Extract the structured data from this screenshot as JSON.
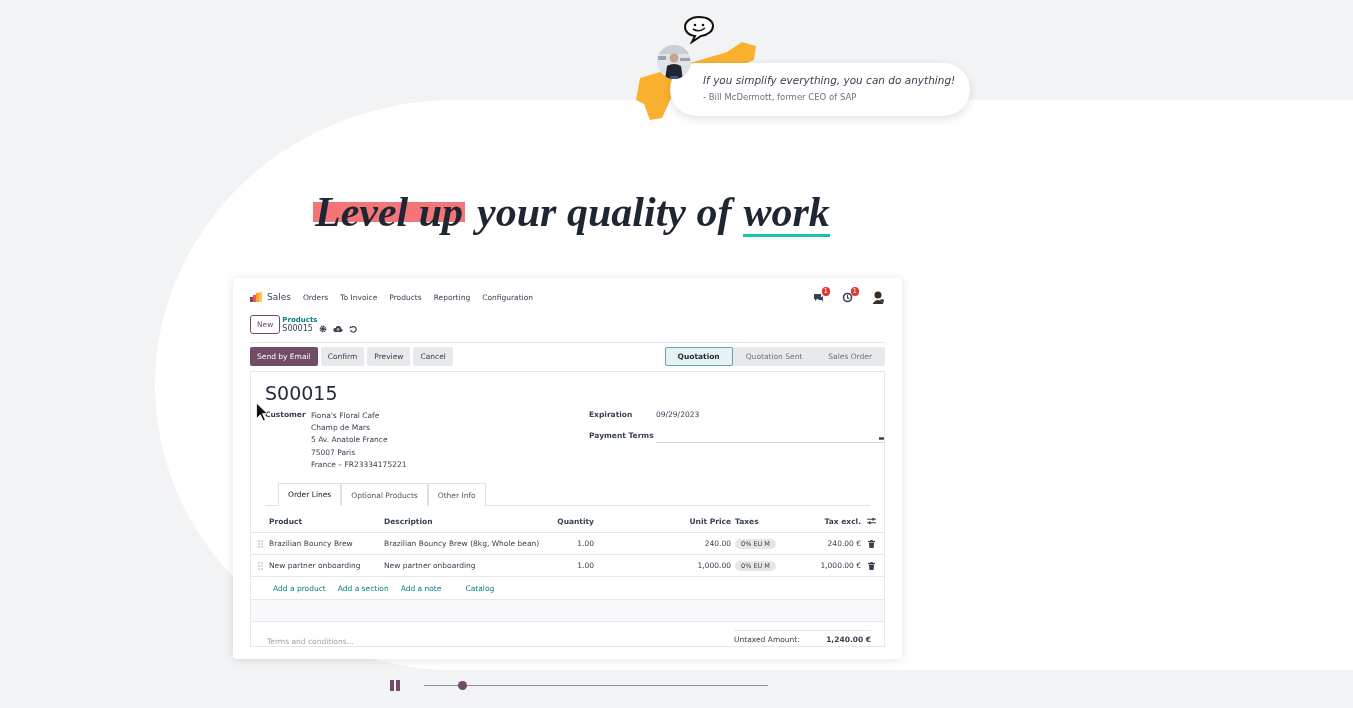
{
  "quote": {
    "text": "If you simplify everything, you can do anything!",
    "author": "- Bill McDermott, former CEO of SAP"
  },
  "headline": [
    {
      "text": "Level up",
      "kind": "highlight"
    },
    {
      "text": "your quality of",
      "kind": "plain"
    },
    {
      "text": "work",
      "kind": "underline"
    }
  ],
  "app": {
    "brand": "Sales",
    "menu": [
      "Orders",
      "To Invoice",
      "Products",
      "Reporting",
      "Configuration"
    ],
    "notifications": [
      {
        "kind": "chat",
        "count": "1"
      },
      {
        "kind": "activity",
        "count": "1"
      }
    ],
    "new_button": "New",
    "breadcrumb": "Products",
    "record": "S00015",
    "actions": [
      {
        "label": "Send by Email",
        "kind": "primary"
      },
      {
        "label": "Confirm",
        "kind": "secondary"
      },
      {
        "label": "Preview",
        "kind": "secondary"
      },
      {
        "label": "Cancel",
        "kind": "secondary"
      }
    ],
    "stages": [
      {
        "label": "Quotation",
        "selected": true
      },
      {
        "label": "Quotation Sent",
        "selected": false
      },
      {
        "label": "Sales Order",
        "selected": false
      }
    ],
    "title": "S00015",
    "customer": {
      "label": "Customer",
      "lines": [
        "Fiona's Floral Cafe",
        "Champ de Mars",
        "5 Av. Anatole France",
        "75007 Paris",
        "France – FR23334175221"
      ]
    },
    "fields": [
      {
        "label": "Expiration",
        "value": "09/29/2023",
        "kind": "text"
      },
      {
        "label": "Payment Terms",
        "kind": "select"
      }
    ],
    "tabs": [
      {
        "label": "Order Lines",
        "selected": true
      },
      {
        "label": "Optional Products",
        "selected": false
      },
      {
        "label": "Other Info",
        "selected": false
      }
    ],
    "columns": [
      "Product",
      "Description",
      "Quantity",
      "Unit Price",
      "Taxes",
      "Tax excl."
    ],
    "rows": [
      {
        "product": "Brazilian Bouncy Brew",
        "description": "Brazilian Bouncy Brew (8kg, Whole bean)",
        "quantity": "1.00",
        "unit_price": "240.00",
        "tax": "0% EU M",
        "subtotal": "240.00 €"
      },
      {
        "product": "New partner onboarding",
        "description": "New partner onboarding",
        "quantity": "1.00",
        "unit_price": "1,000.00",
        "tax": "0% EU M",
        "subtotal": "1,000.00 €"
      }
    ],
    "add_links": [
      "Add a product",
      "Add a section",
      "Add a note",
      "Catalog"
    ],
    "terms_placeholder": "Terms and conditions...",
    "totals": [
      {
        "label": "Untaxed Amount:",
        "value": "1,240.00 €"
      }
    ]
  },
  "player": {
    "playing": true,
    "level": 0.11
  }
}
